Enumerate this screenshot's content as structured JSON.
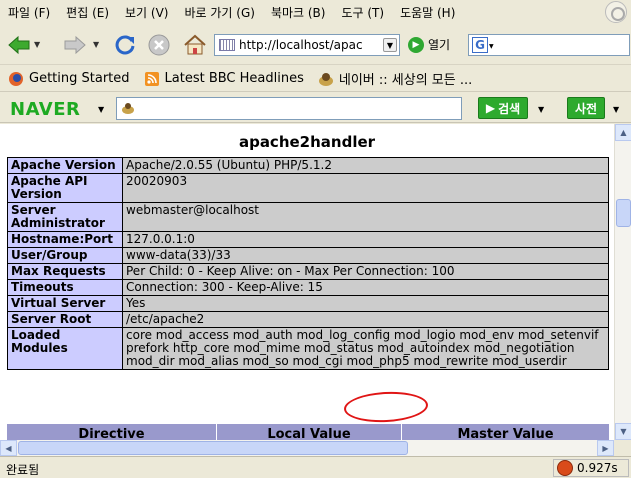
{
  "menu": [
    "파일 (F)",
    "편집 (E)",
    "보기 (V)",
    "바로 가기 (G)",
    "북마크 (B)",
    "도구 (T)",
    "도움말 (H)"
  ],
  "nav": {
    "back_icon": "back-arrow-icon",
    "forward_icon": "forward-arrow-icon",
    "reload_icon": "reload-icon",
    "stop_icon": "stop-icon",
    "home_icon": "home-icon",
    "url": "http://localhost/apac",
    "go_label": "열기",
    "search_engine_icon": "google-icon"
  },
  "bookmarks": [
    {
      "label": "Getting Started",
      "icon": "firefox-icon"
    },
    {
      "label": "Latest BBC Headlines",
      "icon": "rss-icon"
    },
    {
      "label": "네이버 :: 세상의 모든 ...",
      "icon": "naver-favicon"
    }
  ],
  "naver": {
    "logo": "NAVER",
    "search_label": "검색",
    "dict_label": "사전"
  },
  "page": {
    "heading": "apache2handler",
    "rows": [
      {
        "k": "Apache Version",
        "v": "Apache/2.0.55 (Ubuntu) PHP/5.1.2"
      },
      {
        "k": "Apache API Version",
        "v": "20020903"
      },
      {
        "k": "Server Administrator",
        "v": "webmaster@localhost"
      },
      {
        "k": "Hostname:Port",
        "v": "127.0.0.1:0"
      },
      {
        "k": "User/Group",
        "v": "www-data(33)/33"
      },
      {
        "k": "Max Requests",
        "v": "Per Child: 0 - Keep Alive: on - Max Per Connection: 100"
      },
      {
        "k": "Timeouts",
        "v": "Connection: 300 - Keep-Alive: 15"
      },
      {
        "k": "Virtual Server",
        "v": "Yes"
      },
      {
        "k": "Server Root",
        "v": "/etc/apache2"
      },
      {
        "k": "Loaded Modules",
        "v": "core mod_access mod_auth mod_log_config mod_logio mod_env mod_setenvif prefork http_core mod_mime mod_status mod_autoindex mod_negotiation mod_dir mod_alias mod_so mod_cgi mod_php5 mod_rewrite mod_userdir"
      }
    ],
    "directive_headers": [
      "Directive",
      "Local Value",
      "Master Value"
    ],
    "annotation_color": "#e01515"
  },
  "status": {
    "text": "완료됨",
    "time": "0.927s"
  }
}
